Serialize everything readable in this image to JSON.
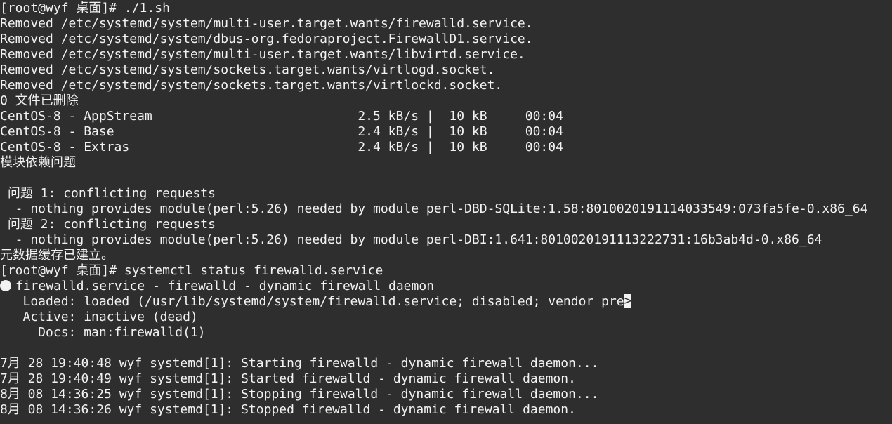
{
  "terminal": {
    "lines": [
      "[root@wyf 桌面]# ./1.sh",
      "Removed /etc/systemd/system/multi-user.target.wants/firewalld.service.",
      "Removed /etc/systemd/system/dbus-org.fedoraproject.FirewallD1.service.",
      "Removed /etc/systemd/system/multi-user.target.wants/libvirtd.service.",
      "Removed /etc/systemd/system/sockets.target.wants/virtlogd.socket.",
      "Removed /etc/systemd/system/sockets.target.wants/virtlockd.socket.",
      "0 文件已删除",
      "CentOS-8 - AppStream                           2.5 kB/s |  10 kB     00:04",
      "CentOS-8 - Base                                2.4 kB/s |  10 kB     00:04",
      "CentOS-8 - Extras                              2.4 kB/s |  10 kB     00:04",
      "模块依赖问题",
      "",
      " 问题 1: conflicting requests",
      "  - nothing provides module(perl:5.26) needed by module perl-DBD-SQLite:1.58:8010020191114033549:073fa5fe-0.x86_64",
      " 问题 2: conflicting requests",
      "  - nothing provides module(perl:5.26) needed by module perl-DBI:1.641:8010020191113222731:16b3ab4d-0.x86_64",
      "元数据缓存已建立。",
      "[root@wyf 桌面]# systemctl status firewalld.service"
    ],
    "status_header": "firewalld.service - firewalld - dynamic firewall daemon",
    "loaded_line_prefix": "   Loaded: loaded (/usr/lib/systemd/system/firewalld.service; disabled; vendor pre",
    "cursor_char": ">",
    "status_lines": [
      "   Active: inactive (dead)",
      "     Docs: man:firewalld(1)",
      "",
      "7月 28 19:40:48 wyf systemd[1]: Starting firewalld - dynamic firewall daemon...",
      "7月 28 19:40:49 wyf systemd[1]: Started firewalld - dynamic firewall daemon.",
      "8月 08 14:36:25 wyf systemd[1]: Stopping firewalld - dynamic firewall daemon...",
      "8月 08 14:36:26 wyf systemd[1]: Stopped firewalld - dynamic firewall daemon."
    ]
  }
}
